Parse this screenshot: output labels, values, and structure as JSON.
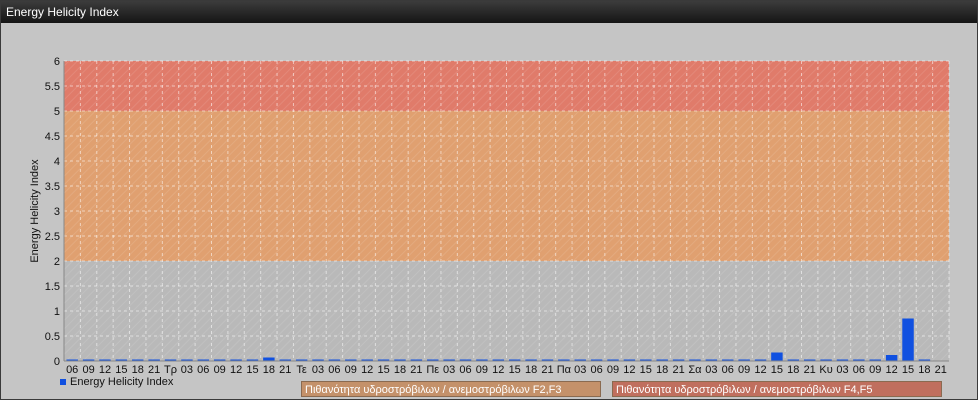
{
  "window": {
    "title": "Energy Helicity Index"
  },
  "chart_data": {
    "type": "bar",
    "ylabel": "Energy Helicity Index",
    "ylim": [
      0,
      6
    ],
    "yticks": [
      "0",
      "0.5",
      "1",
      "1.5",
      "2",
      "2.5",
      "3",
      "3.5",
      "4",
      "4.5",
      "5",
      "5.5",
      "6"
    ],
    "categories": [
      "06",
      "09",
      "12",
      "15",
      "18",
      "21",
      "Τρ",
      "03",
      "06",
      "09",
      "12",
      "15",
      "18",
      "21",
      "Τε",
      "03",
      "06",
      "09",
      "12",
      "15",
      "18",
      "21",
      "Πε",
      "03",
      "06",
      "09",
      "12",
      "15",
      "18",
      "21",
      "Πα",
      "03",
      "06",
      "09",
      "12",
      "15",
      "18",
      "21",
      "Σα",
      "03",
      "06",
      "09",
      "12",
      "15",
      "18",
      "21",
      "Κυ",
      "03",
      "06",
      "09",
      "12",
      "15",
      "18",
      "21"
    ],
    "series": [
      {
        "name": "Energy Helicity Index",
        "values": [
          0.01,
          0.01,
          0.01,
          0.02,
          0.02,
          0.01,
          0.01,
          0.01,
          0.01,
          0.01,
          0.02,
          0.03,
          0.07,
          0.01,
          0.01,
          0.01,
          0.01,
          0.01,
          0.01,
          0.01,
          0.01,
          0.01,
          0.01,
          0.01,
          0.01,
          0.01,
          0.01,
          0.02,
          0.01,
          0.01,
          0.01,
          0.01,
          0.01,
          0.01,
          0.01,
          0.02,
          0.01,
          0.01,
          0.01,
          0.01,
          0.01,
          0.01,
          0.01,
          0.17,
          0.01,
          0.01,
          0.01,
          0.01,
          0.01,
          0.01,
          0.12,
          0.85,
          0.01
        ]
      }
    ],
    "zones": [
      {
        "from": 2,
        "to": 5,
        "color": "#e0a070",
        "label": "Πιθανότητα υδροστρόβιλων / ανεμοστρόβιλων F2,F3"
      },
      {
        "from": 5,
        "to": 6,
        "color": "#e07b6a",
        "label": "Πιθανότητα υδροστρόβιλων / ανεμοστρόβιλων F4,F5"
      }
    ],
    "bar_color": "#1050e0",
    "grid": true
  }
}
